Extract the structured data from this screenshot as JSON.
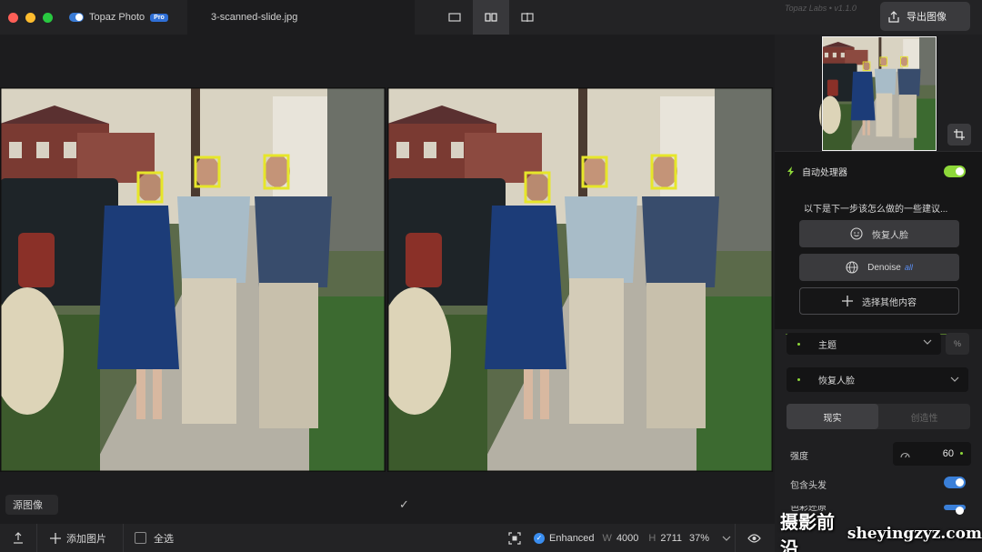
{
  "titlebar": {
    "app_name": "Topaz Photo",
    "pro_badge": "Pro",
    "file_tab": "3-scanned-slide.jpg",
    "version": "Topaz Labs  •  v1.1.0",
    "export_label": "导出图像"
  },
  "canvas": {
    "source_label": "源图像",
    "confirm": "✓"
  },
  "bottombar": {
    "add_images": "添加图片",
    "select_all": "全选",
    "enhanced": "Enhanced",
    "w_label": "W",
    "w_value": "4000",
    "h_label": "H",
    "h_value": "2711",
    "zoom": "37%"
  },
  "panel": {
    "auto_title": "自动处理器",
    "suggest_text": "以下是下一步该怎么做的一些建议...",
    "suggest_restore_face": "恢复人脸",
    "suggest_denoise": "Denoise",
    "suggest_denoise_tag": "all",
    "suggest_other": "选择其他内容",
    "subject_dropdown": "主题",
    "model_dropdown": "恢复人脸",
    "tab_realistic": "现实",
    "tab_creative": "创造性",
    "strength_label": "强度",
    "strength_value": "60",
    "include_hair": "包含头发",
    "next_row": "色彩还原"
  },
  "watermark": {
    "text": "摄影前沿",
    "domain": "sheyingzyz.com"
  },
  "colors": {
    "accent_green": "#8ed83a",
    "accent_blue": "#3a7fd8",
    "face_box": "#e6e62a"
  },
  "icons": [
    "share-icon",
    "layout-single-icon",
    "layout-split-icon",
    "layout-compare-icon",
    "export-icon",
    "crop-icon",
    "bolt-icon",
    "face-icon",
    "globe-icon",
    "plus-icon",
    "chevron-down-icon",
    "eye-icon",
    "fit-icon",
    "check-icon",
    "gauge-icon"
  ]
}
